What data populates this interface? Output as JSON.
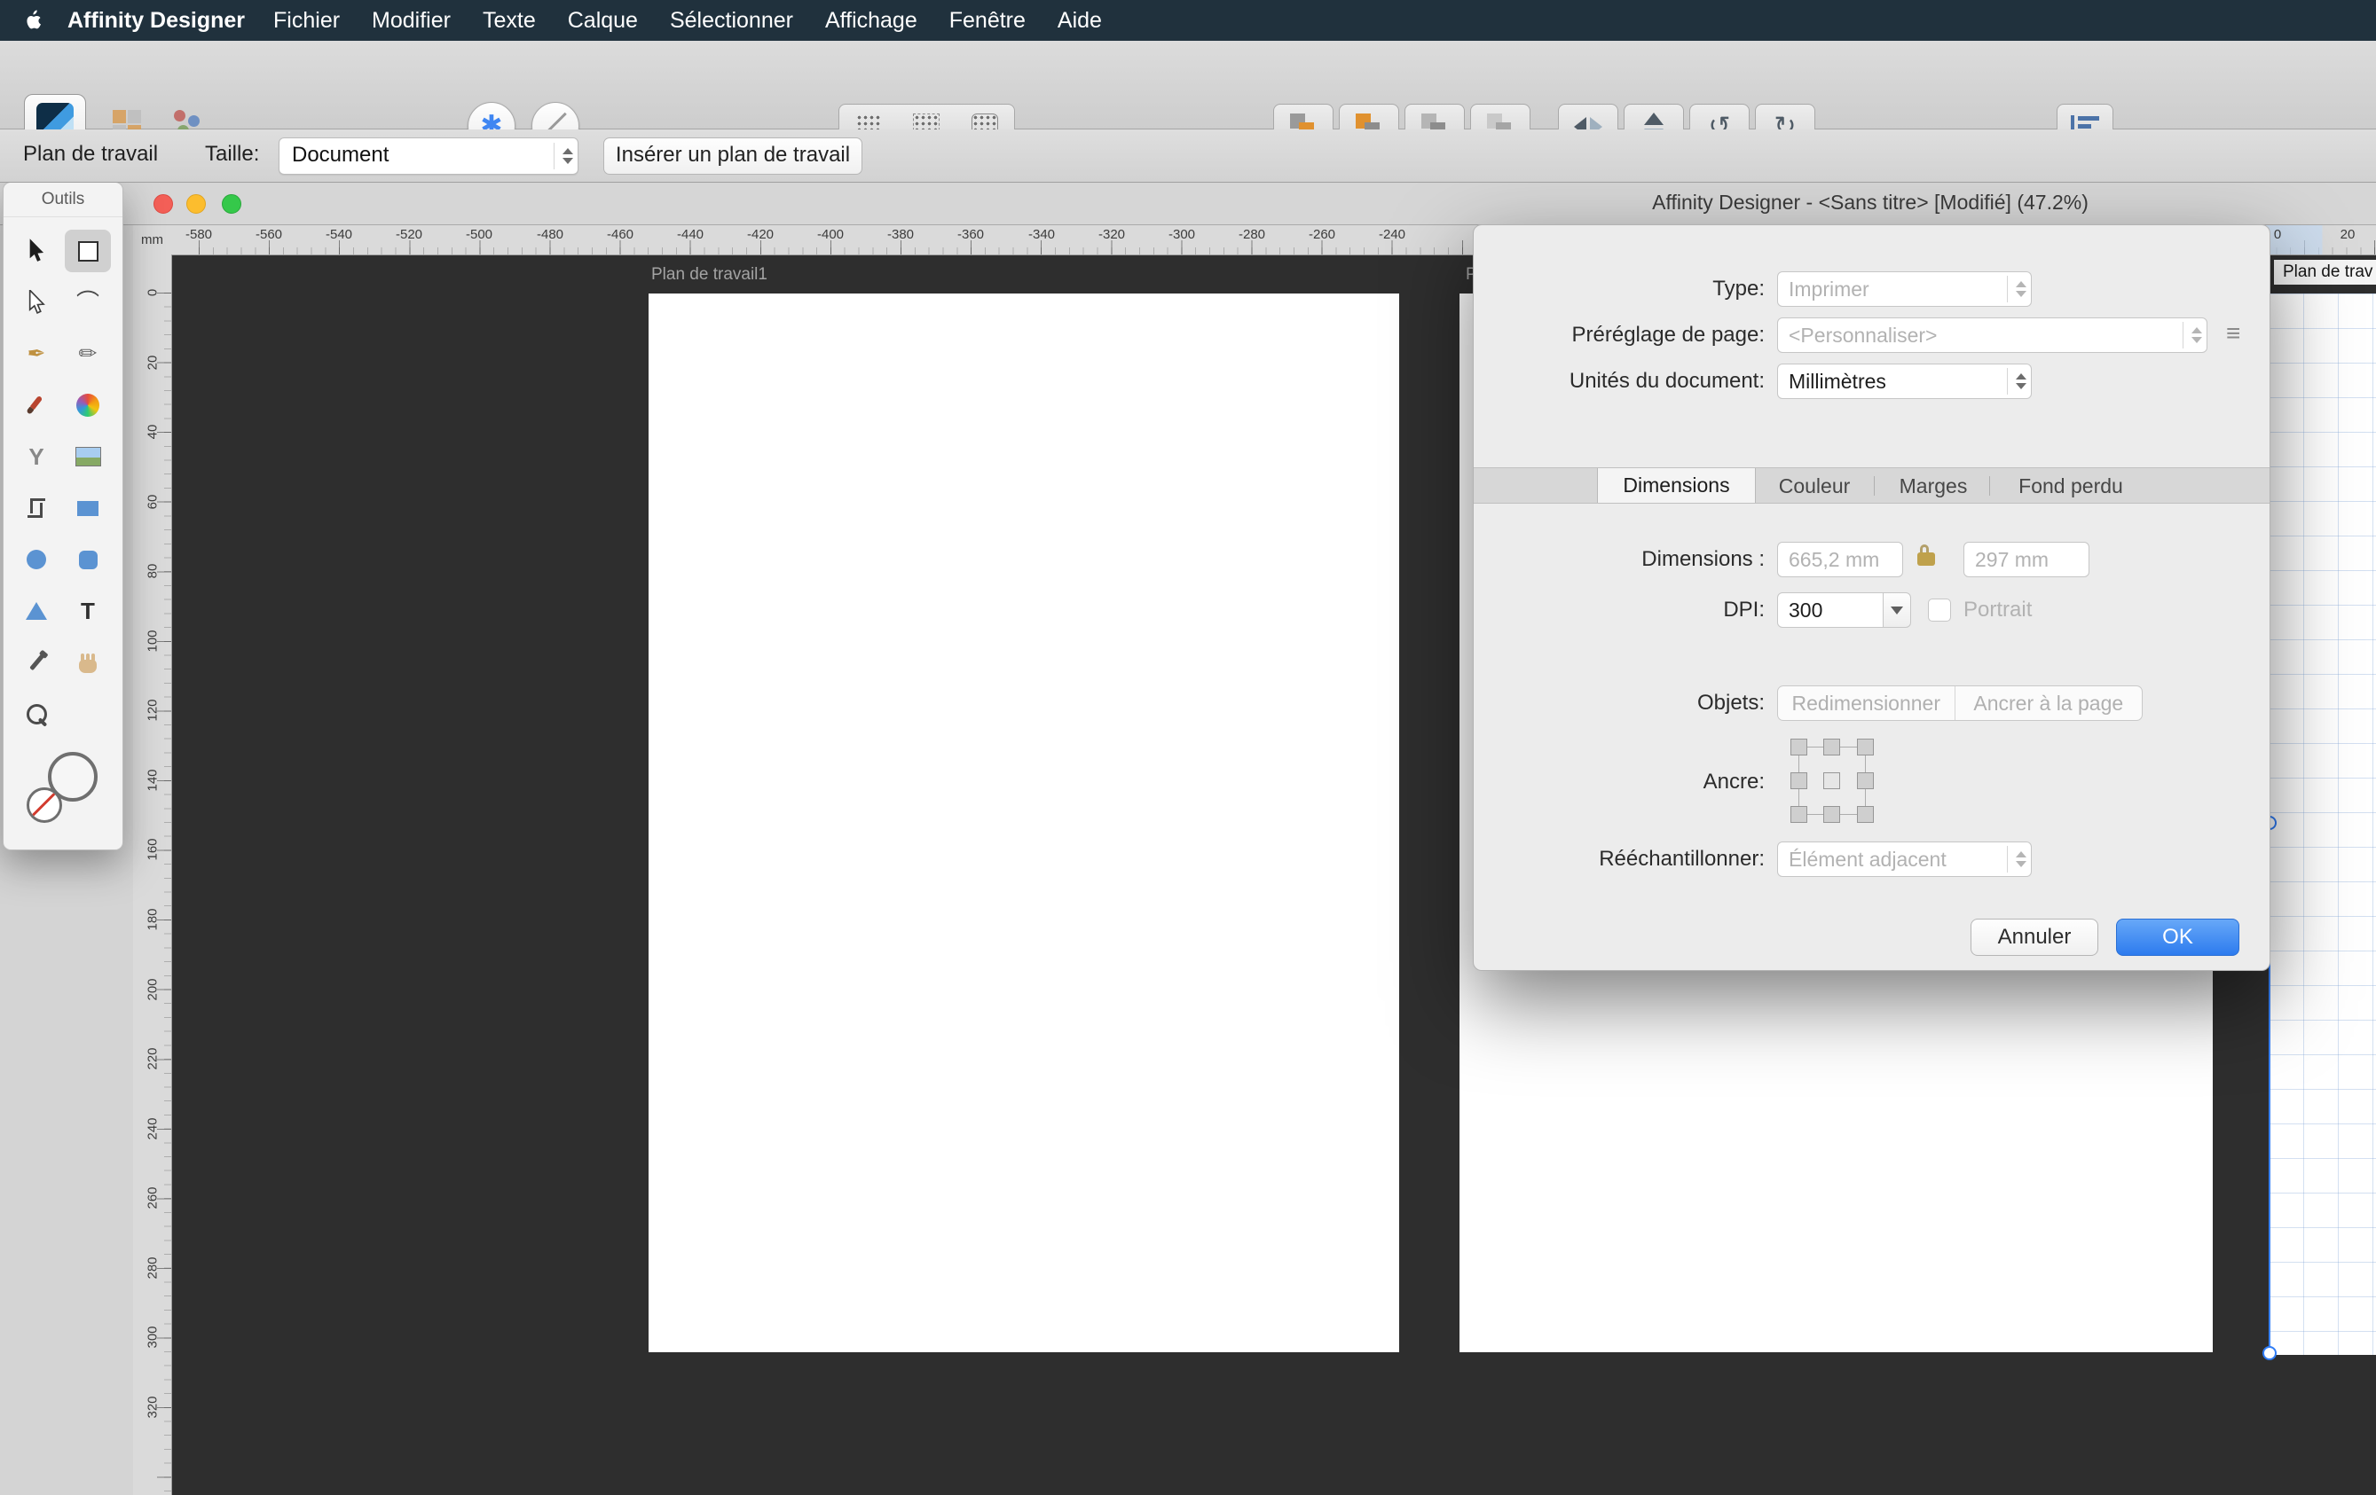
{
  "colors": {
    "accent_blue": "#2f7cf6",
    "ok_button_blue": "#2d7bee",
    "canvas_background": "#2e2e2e",
    "menubar_background": "#20313d"
  },
  "menubar": {
    "app_name": "Affinity Designer",
    "items": [
      "Fichier",
      "Modifier",
      "Texte",
      "Calque",
      "Sélectionner",
      "Affichage",
      "Fenêtre",
      "Aide"
    ]
  },
  "toolbar": {
    "icons": [
      "vector-persona",
      "pixel-persona",
      "export-persona",
      "snapping-toggle",
      "no-style-toggle",
      "grid-mode-1",
      "grid-mode-2",
      "grid-mode-3",
      "insert-behind",
      "insert-inside",
      "insert-on-top",
      "replace-selection",
      "flip-horizontal",
      "flip-vertical",
      "rotate-ccw",
      "rotate-cw",
      "alignment"
    ],
    "rotate_ccw_glyph": "↺",
    "rotate_cw_glyph": "↻",
    "snap_glyph": "✱"
  },
  "context_bar": {
    "tool_label": "Plan de travail",
    "size_label": "Taille:",
    "size_value": "Document",
    "insert_button": "Insérer un plan de travail"
  },
  "window": {
    "title": "Affinity Designer - <Sans titre> [Modifié] (47.2%)"
  },
  "tools": {
    "title": "Outils",
    "glyphs": {
      "corner": "⌒",
      "pen": "✒",
      "pencil": "✏",
      "transparency": "Y",
      "text": "T"
    }
  },
  "ruler": {
    "unit": "mm",
    "h_left": [
      "-580",
      "-560",
      "-540",
      "-520",
      "-500",
      "-480",
      "-460",
      "-440",
      "-420",
      "-400",
      "-380",
      "-360",
      "-340",
      "-320",
      "-300",
      "-280",
      "-260",
      "-240"
    ],
    "h_right": [
      "0",
      "20"
    ],
    "v": [
      "0",
      "20",
      "40",
      "60",
      "80",
      "100",
      "120",
      "140",
      "160",
      "180",
      "200",
      "220",
      "240",
      "260",
      "280",
      "300",
      "320"
    ]
  },
  "canvas": {
    "artboard1_label": "Plan de travail1",
    "artboard2_label": "P",
    "artboard3_label": "Plan de trav"
  },
  "dialog": {
    "type": {
      "label": "Type:",
      "value": "Imprimer"
    },
    "preset": {
      "label": "Préréglage de page:",
      "value": "<Personnaliser>"
    },
    "units": {
      "label": "Unités du document:",
      "value": "Millimètres"
    },
    "tabs": [
      "Dimensions",
      "Couleur",
      "Marges",
      "Fond perdu"
    ],
    "active_tab": "Dimensions",
    "dimensions": {
      "label": "Dimensions :",
      "width": "665,2 mm",
      "height": "297 mm"
    },
    "dpi": {
      "label": "DPI:",
      "value": "300"
    },
    "portrait_label": "Portrait",
    "objects": {
      "label": "Objets:",
      "options": [
        "Redimensionner",
        "Ancrer à la page"
      ]
    },
    "anchor_label": "Ancre:",
    "resample": {
      "label": "Rééchantillonner:",
      "value": "Élément adjacent"
    },
    "buttons": {
      "cancel": "Annuler",
      "ok": "OK"
    }
  }
}
